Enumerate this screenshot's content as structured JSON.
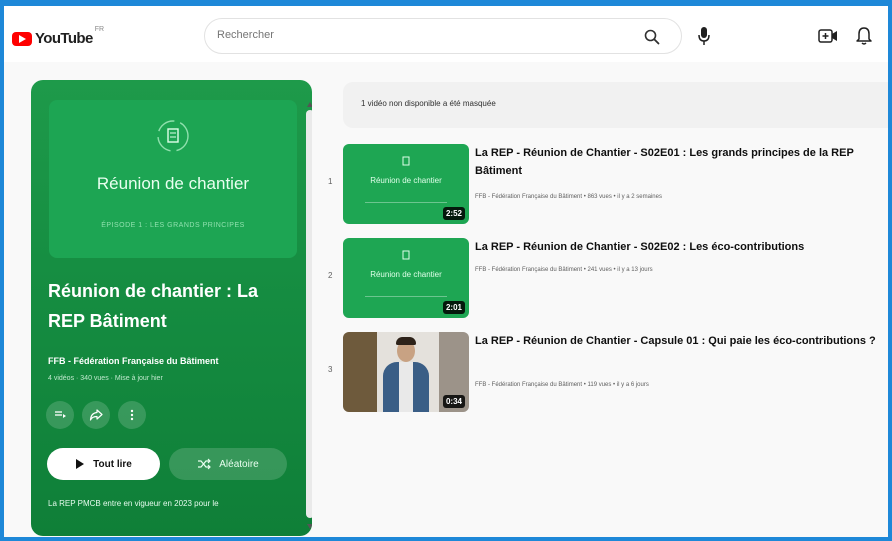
{
  "header": {
    "logo_text": "YouTube",
    "logo_sup": "FR",
    "search_placeholder": "Rechercher"
  },
  "icons": {
    "search": "search-icon",
    "mic": "mic-icon",
    "create": "video-create-icon",
    "notifications": "bell-icon"
  },
  "playlist": {
    "thumbnail_title": "Réunion de chantier",
    "thumbnail_subtitle": "ÉPISODE 1 : LES GRANDS PRINCIPES",
    "title": "Réunion de chantier : La REP Bâtiment",
    "channel": "FFB - Fédération Française du Bâtiment",
    "meta": "4 vidéos · 340 vues · Mise à jour hier",
    "play_all": "Tout lire",
    "shuffle": "Aléatoire",
    "description": "La REP PMCB entre en vigueur en 2023 pour le"
  },
  "hidden_notice": "1 vidéo non disponible a été masquée",
  "videos": [
    {
      "index": "1",
      "title": "La REP - Réunion de Chantier - S02E01 : Les grands principes de la REP Bâtiment",
      "thumb_title": "Réunion de chantier",
      "duration": "2:52",
      "meta": "FFB - Fédération Française du Bâtiment • 863 vues • il y a 2 semaines"
    },
    {
      "index": "2",
      "title": "La REP - Réunion de Chantier - S02E02 : Les éco-contributions",
      "thumb_title": "Réunion de chantier",
      "duration": "2:01",
      "meta": "FFB - Fédération Française du Bâtiment • 241 vues • il y a 13 jours"
    },
    {
      "index": "3",
      "title": "La REP - Réunion de Chantier - Capsule 01 : Qui paie les éco-contributions ?",
      "duration": "0:34",
      "meta": "FFB - Fédération Française du Bâtiment • 119 vues • il y a 6 jours"
    }
  ],
  "colors": {
    "brand_red": "#ff0000",
    "playlist_green": "#168e42",
    "frame_blue": "#1e88d8"
  }
}
